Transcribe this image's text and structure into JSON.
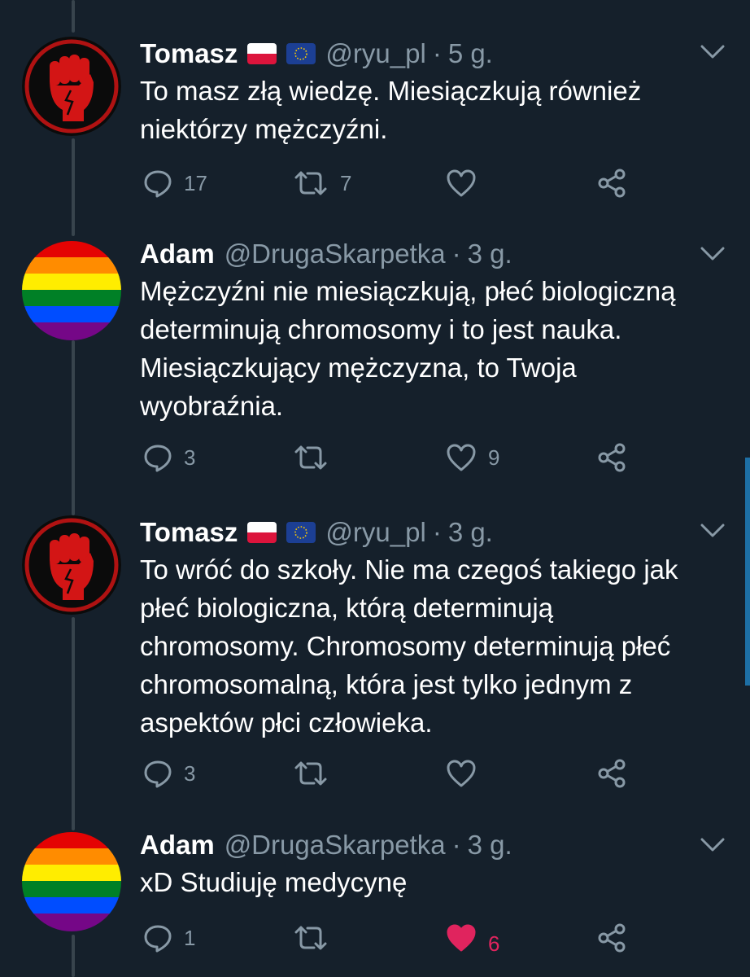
{
  "colors": {
    "background": "#15202b",
    "text": "#ffffff",
    "secondary": "#8899a6",
    "like_active": "#e0245e",
    "thread_line": "#38444d",
    "scrollbar": "#1d6fa5"
  },
  "tweets": [
    {
      "name": "Tomasz",
      "flags": [
        "poland-flag-icon",
        "eu-flag-icon"
      ],
      "handle": "@ryu_pl",
      "sep": "·",
      "time": "5 g.",
      "text": "To masz złą wiedzę. Miesiączkują również\nniektórzy mężczyźni.",
      "reply_count": "17",
      "retweet_count": "7",
      "like_count": "",
      "liked": false,
      "avatar": "raised-fist-avatar"
    },
    {
      "name": "Adam",
      "flags": [],
      "handle": "@DrugaSkarpetka",
      "sep": "·",
      "time": "3 g.",
      "text": "Mężczyźni nie miesiączkują, płeć biologiczną\ndeterminują chromosomy i to jest nauka.\nMiesiączkujący mężczyzna, to Twoja\nwyobraźnia.",
      "reply_count": "3",
      "retweet_count": "",
      "like_count": "9",
      "liked": false,
      "avatar": "rainbow-flag-avatar"
    },
    {
      "name": "Tomasz",
      "flags": [
        "poland-flag-icon",
        "eu-flag-icon"
      ],
      "handle": "@ryu_pl",
      "sep": "·",
      "time": "3 g.",
      "text": "To wróć do szkoły. Nie ma czegoś takiego jak\npłeć biologiczna, którą determinują\nchromosomy. Chromosomy determinują płeć\nchromosomalną, która jest tylko jednym z\naspektów płci człowieka.",
      "reply_count": "3",
      "retweet_count": "",
      "like_count": "",
      "liked": false,
      "avatar": "raised-fist-avatar"
    },
    {
      "name": "Adam",
      "flags": [],
      "handle": "@DrugaSkarpetka",
      "sep": "·",
      "time": "3 g.",
      "text": "xD Studiuję medycynę",
      "reply_count": "1",
      "retweet_count": "",
      "like_count": "6",
      "liked": true,
      "avatar": "rainbow-flag-avatar"
    }
  ]
}
